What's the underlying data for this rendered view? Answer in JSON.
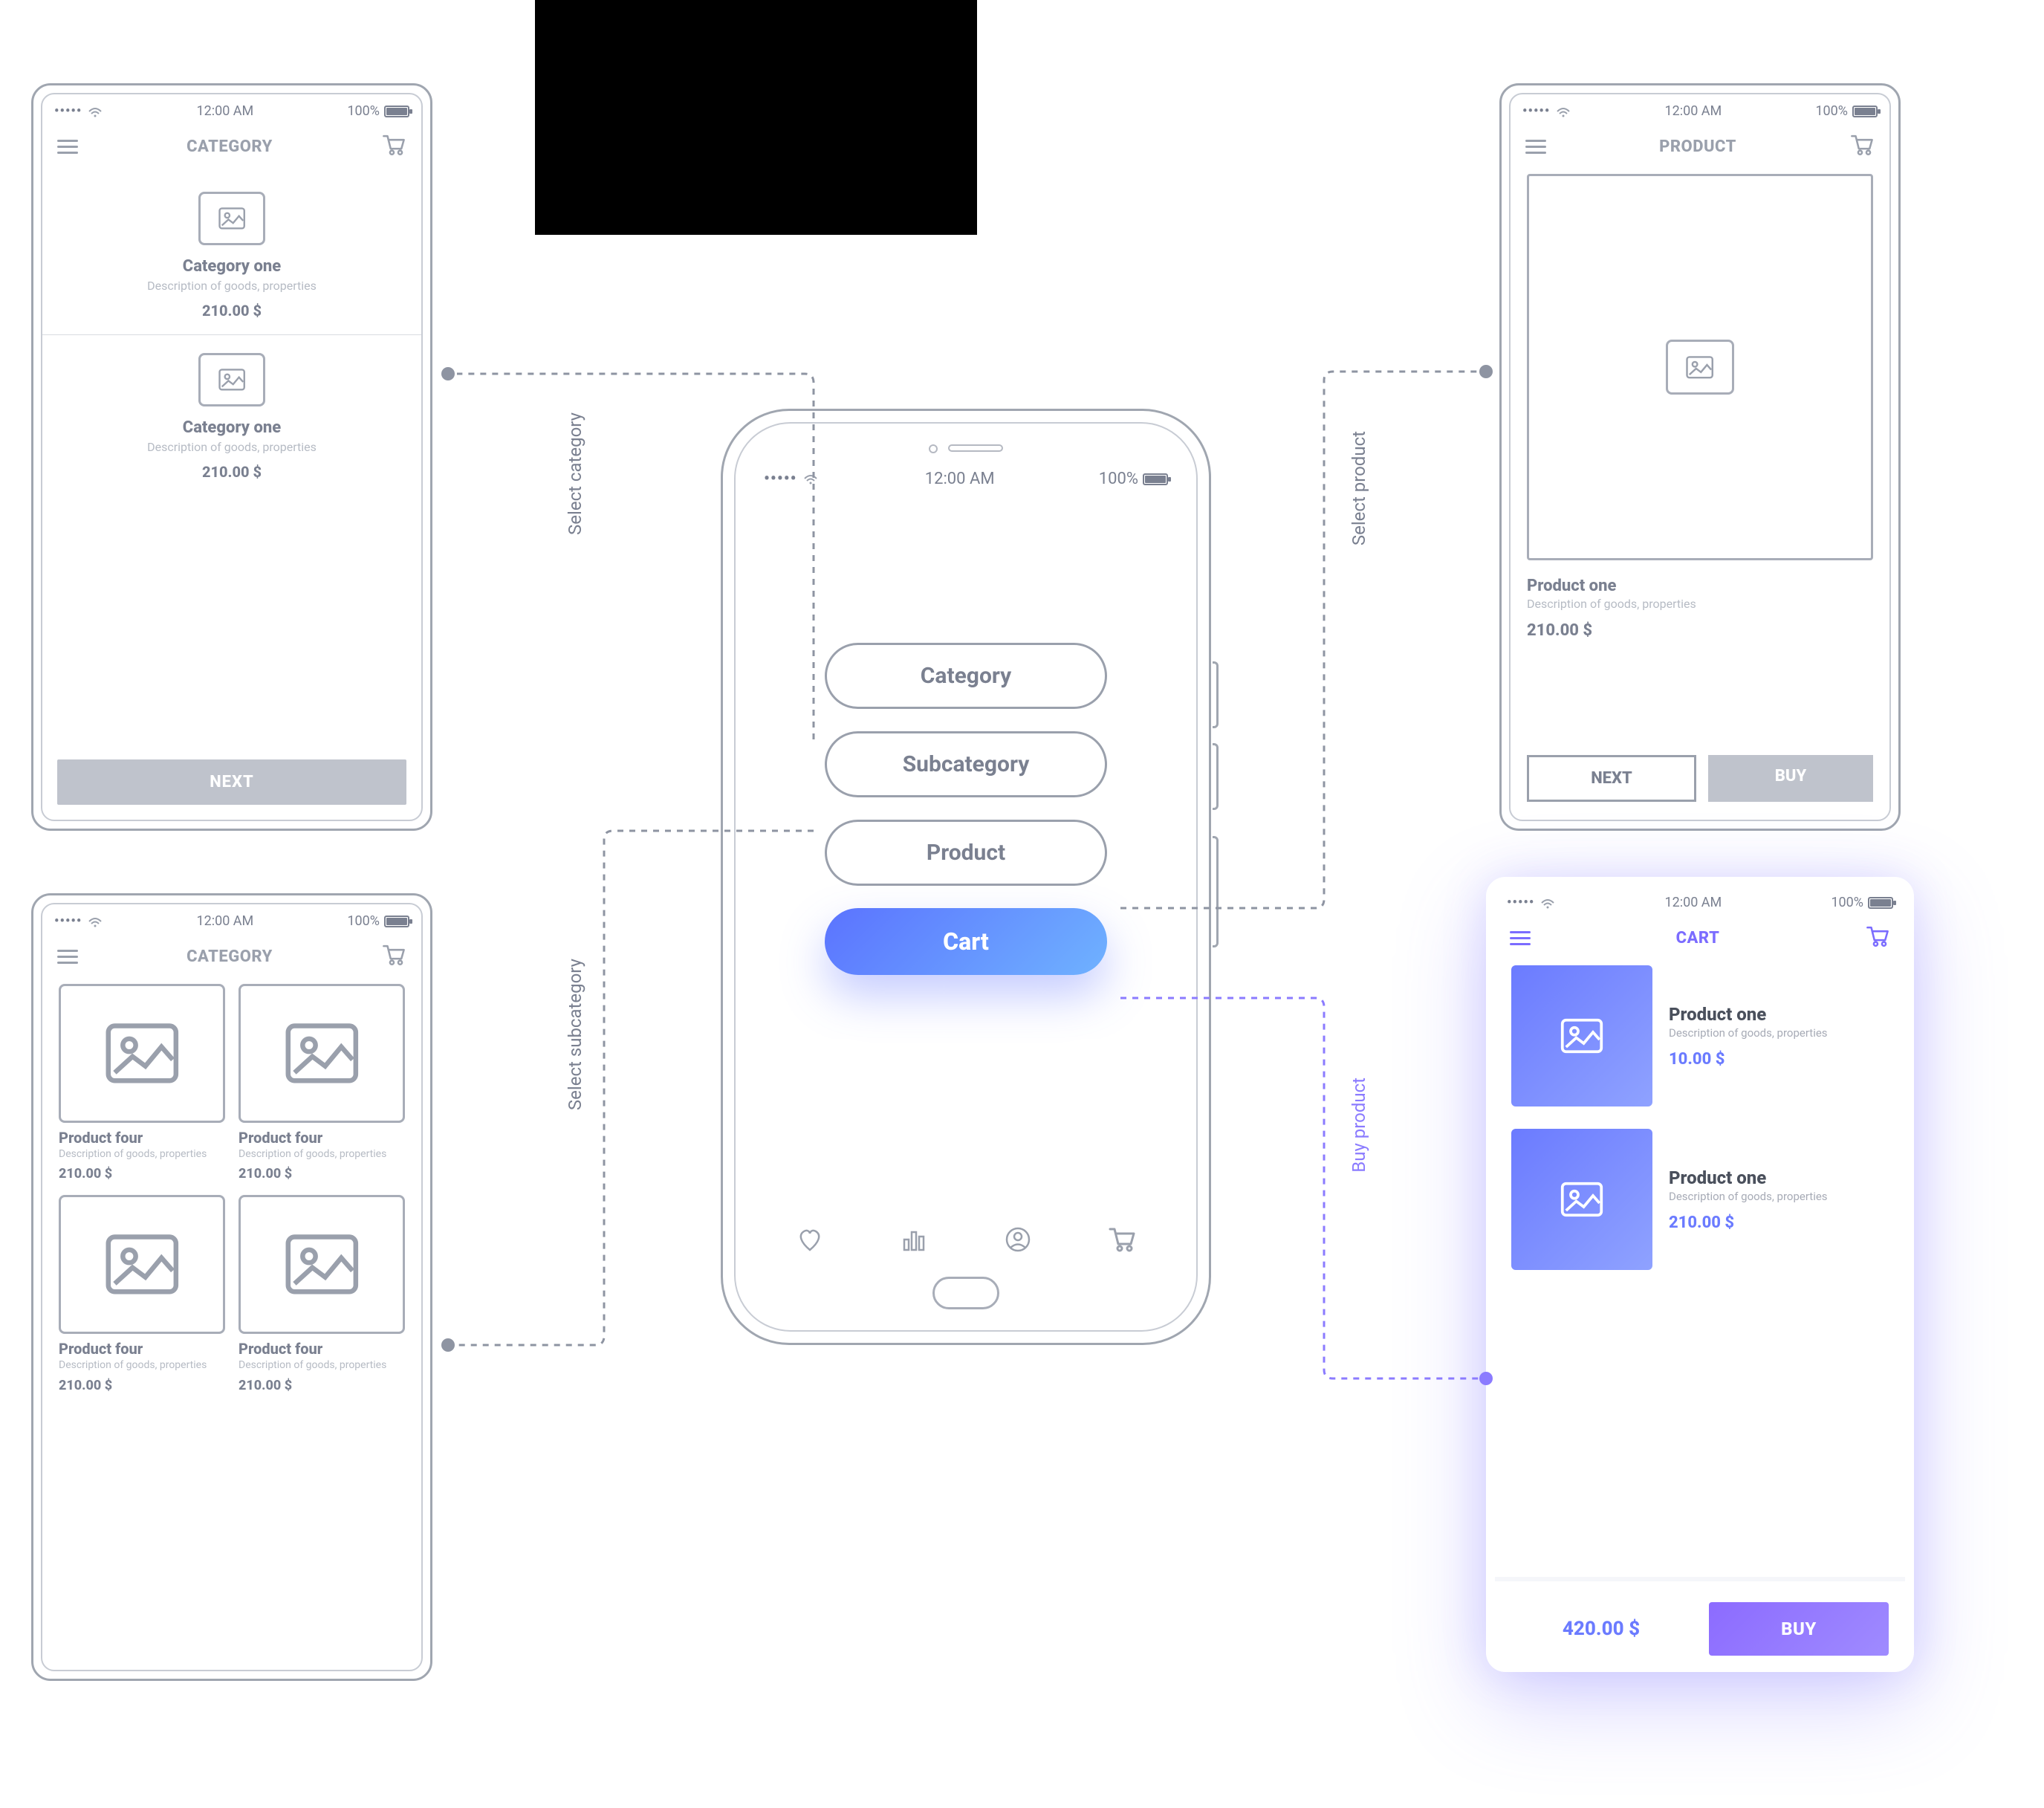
{
  "status": {
    "time": "12:00 AM",
    "battery_pct": "100%"
  },
  "screen_category": {
    "title": "CATEGORY",
    "items": [
      {
        "name": "Category one",
        "desc": "Description of goods, properties",
        "price": "210.00 $"
      },
      {
        "name": "Category one",
        "desc": "Description of goods, properties",
        "price": "210.00 $"
      }
    ],
    "next_label": "NEXT"
  },
  "screen_subcategory": {
    "title": "CATEGORY",
    "items": [
      {
        "name": "Product four",
        "desc": "Description of goods, properties",
        "price": "210.00 $"
      },
      {
        "name": "Product four",
        "desc": "Description of goods, properties",
        "price": "210.00 $"
      },
      {
        "name": "Product four",
        "desc": "Description of goods, properties",
        "price": "210.00 $"
      },
      {
        "name": "Product four",
        "desc": "Description of goods, properties",
        "price": "210.00 $"
      }
    ]
  },
  "screen_product": {
    "title": "PRODUCT",
    "name": "Product one",
    "desc": "Description of goods, properties",
    "price": "210.00 $",
    "next_label": "NEXT",
    "buy_label": "BUY"
  },
  "screen_cart": {
    "title": "CART",
    "items": [
      {
        "name": "Product one",
        "desc": "Description of goods, properties",
        "price": "10.00 $"
      },
      {
        "name": "Product one",
        "desc": "Description of goods, properties",
        "price": "210.00 $"
      }
    ],
    "total": "420.00 $",
    "buy_label": "BUY"
  },
  "center_nav": {
    "category": "Category",
    "subcategory": "Subcategory",
    "product": "Product",
    "cart": "Cart"
  },
  "flow_labels": {
    "select_category": "Select category",
    "select_subcategory": "Select subcategory",
    "select_product": "Select product",
    "buy_product": "Buy product"
  }
}
